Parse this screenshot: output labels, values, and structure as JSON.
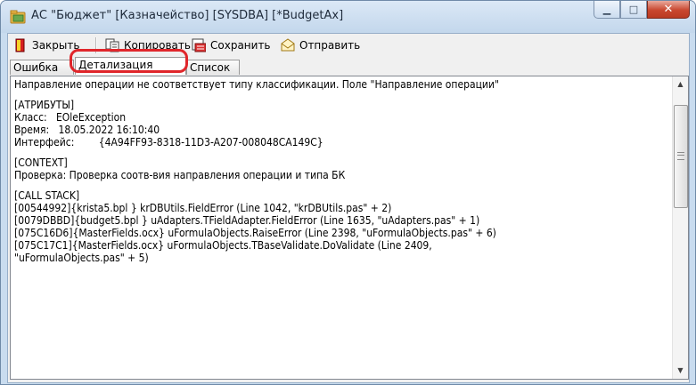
{
  "window": {
    "title": "АС \"Бюджет\" [Казначейство] [SYSDBA] [*BudgetAx]",
    "controls": {
      "minimize": "▁",
      "maximize": "□",
      "close": "✕"
    }
  },
  "toolbar": {
    "close_label": "Закрыть",
    "copy_label": "Копировать",
    "save_label": "Сохранить",
    "send_label": "Отправить"
  },
  "tabs": [
    {
      "label": "Ошибка",
      "active": false
    },
    {
      "label": "Детализация",
      "active": true
    },
    {
      "label": "Список",
      "active": false
    }
  ],
  "detail_lines": [
    "Направление операции не соответствует типу классификации. Поле \"Направление операции\"",
    "",
    "[АТРИБУТЫ]",
    "Класс:   EOleException",
    "Время:   18.05.2022 16:10:40",
    "Интерфейс:        {4A94FF93-8318-11D3-A207-008048CA149C}",
    "",
    "[CONTEXT]",
    "Проверка: Проверка соотв-вия направления операции и типа БК",
    "",
    "[CALL STACK]",
    "[00544992]{krista5.bpl } krDBUtils.FieldError (Line 1042, \"krDBUtils.pas\" + 2)",
    "[0079DBBD]{budget5.bpl } uAdapters.TFieldAdapter.FieldError (Line 1635, \"uAdapters.pas\" + 1)",
    "[075C16D6]{MasterFields.ocx} uFormulaObjects.RaiseError (Line 2398, \"uFormulaObjects.pas\" + 6)",
    "[075C17C1]{MasterFields.ocx} uFormulaObjects.TBaseValidate.DoValidate (Line 2409,",
    "\"uFormulaObjects.pas\" + 5)"
  ],
  "colors": {
    "highlight": "#e0262b",
    "close_button": "#c9472f"
  }
}
